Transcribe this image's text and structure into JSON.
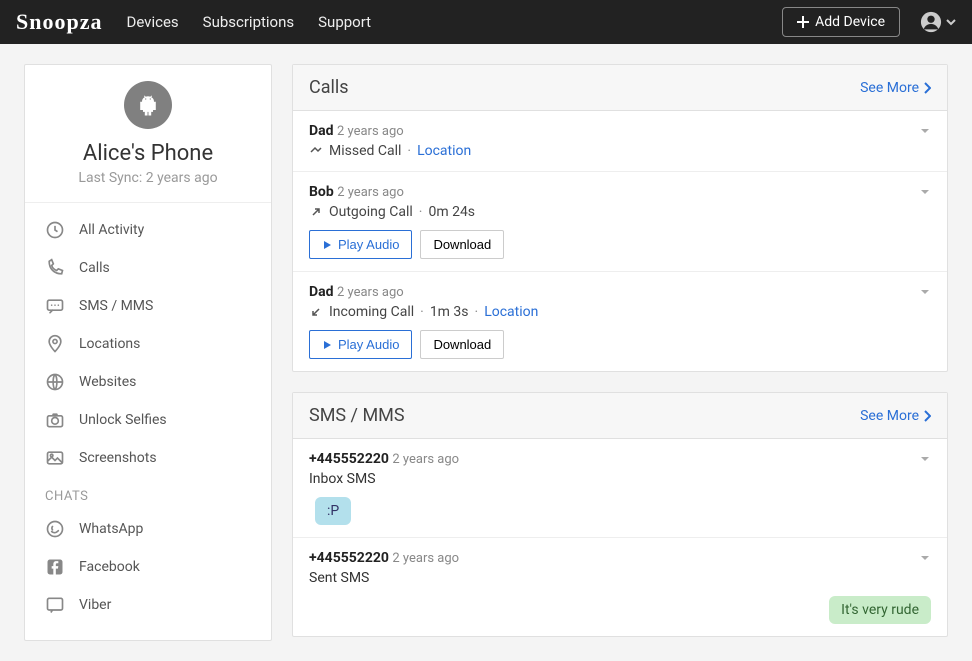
{
  "brand": "Snoopza",
  "topnav": {
    "devices": "Devices",
    "subscriptions": "Subscriptions",
    "support": "Support"
  },
  "add_device_btn": "Add Device",
  "device": {
    "name": "Alice's Phone",
    "sync_prefix": "Last Sync:",
    "sync_time": "2 years ago"
  },
  "sidebar": {
    "items": [
      {
        "label": "All Activity"
      },
      {
        "label": "Calls"
      },
      {
        "label": "SMS / MMS"
      },
      {
        "label": "Locations"
      },
      {
        "label": "Websites"
      },
      {
        "label": "Unlock Selfies"
      },
      {
        "label": "Screenshots"
      }
    ],
    "chats_label": "CHATS",
    "chats": [
      {
        "label": "WhatsApp"
      },
      {
        "label": "Facebook"
      },
      {
        "label": "Viber"
      }
    ]
  },
  "see_more": "See More",
  "calls_panel": {
    "title": "Calls",
    "items": [
      {
        "name": "Dad",
        "time": "2 years ago",
        "type": "Missed Call",
        "duration": "",
        "location": "Location",
        "has_audio": false
      },
      {
        "name": "Bob",
        "time": "2 years ago",
        "type": "Outgoing Call",
        "duration": "0m 24s",
        "location": "",
        "has_audio": true
      },
      {
        "name": "Dad",
        "time": "2 years ago",
        "type": "Incoming Call",
        "duration": "1m 3s",
        "location": "Location",
        "has_audio": true
      }
    ]
  },
  "sms_panel": {
    "title": "SMS / MMS",
    "items": [
      {
        "from": "+445552220",
        "time": "2 years ago",
        "type": "Inbox SMS",
        "body": ":P",
        "dir": "in"
      },
      {
        "from": "+445552220",
        "time": "2 years ago",
        "type": "Sent SMS",
        "body": "It's very rude",
        "dir": "out"
      }
    ]
  },
  "buttons": {
    "play_audio": "Play Audio",
    "download": "Download"
  }
}
